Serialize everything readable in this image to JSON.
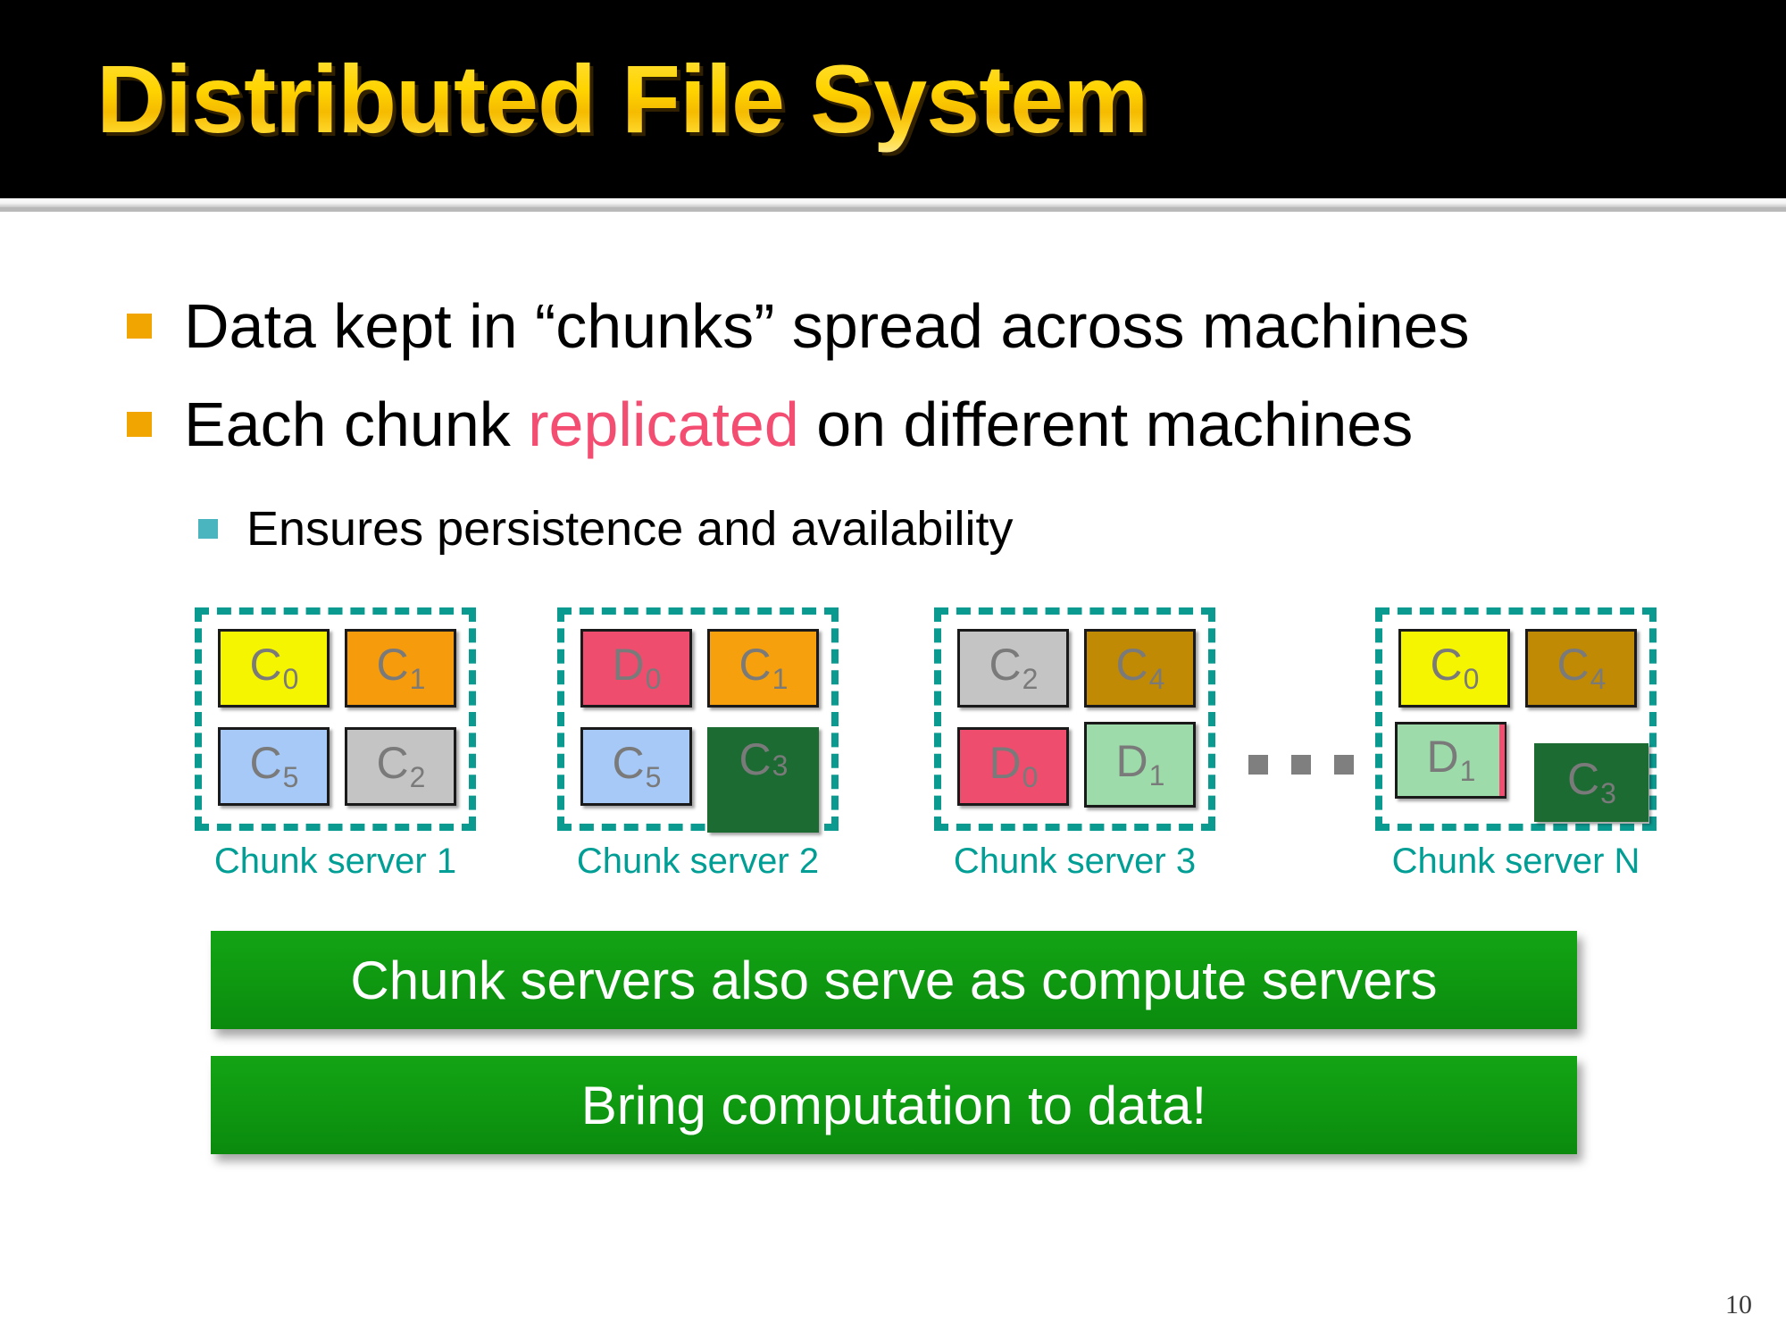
{
  "slide": {
    "title": "Distributed File System",
    "page_number": "10",
    "title_gradient_top": "#ffe247",
    "title_gradient_bottom": "#f5bb00",
    "header_background": "#000000"
  },
  "bullets": [
    {
      "level": 1,
      "marker_color": "#f0a500",
      "prefix": "Data kept in “chunks” spread across machines",
      "accent": "",
      "suffix": ""
    },
    {
      "level": 1,
      "marker_color": "#f0a500",
      "prefix": "Each chunk ",
      "accent": "replicated",
      "accent_color": "#f44d72",
      "suffix": " on different machines"
    },
    {
      "level": 2,
      "marker_color": "#4ab5bf",
      "prefix": "Ensures persistence and availability",
      "accent": "",
      "suffix": ""
    }
  ],
  "diagram": {
    "frame_color": "#0b9a90",
    "label_color": "#009e94",
    "chunk_label_color": "#7a7a7a",
    "ellipsis_color": "#7f7f7f",
    "servers": [
      {
        "label": "Chunk server 1",
        "chunks": [
          {
            "name": "C",
            "index": "0",
            "color": "#f5f500"
          },
          {
            "name": "C",
            "index": "1",
            "color": "#f59b0c"
          },
          {
            "name": "C",
            "index": "5",
            "color": "#a6c9f7"
          },
          {
            "name": "C",
            "index": "2",
            "color": "#c4c4c4"
          }
        ]
      },
      {
        "label": "Chunk server 2",
        "chunks": [
          {
            "name": "D",
            "index": "0",
            "color": "#ef4d6e"
          },
          {
            "name": "C",
            "index": "1",
            "color": "#f5a00c"
          },
          {
            "name": "C",
            "index": "5",
            "color": "#a6c9f7"
          },
          {
            "name": "C",
            "index": "3",
            "color": "#1b6b33"
          }
        ]
      },
      {
        "label": "Chunk server 3",
        "chunks": [
          {
            "name": "C",
            "index": "2",
            "color": "#c4c4c4"
          },
          {
            "name": "C",
            "index": "4",
            "color": "#c08a04"
          },
          {
            "name": "D",
            "index": "0",
            "color": "#ef4d6e"
          },
          {
            "name": "D",
            "index": "1",
            "color": "#9ddcaa"
          }
        ]
      },
      {
        "label": "Chunk server N",
        "chunks": [
          {
            "name": "C",
            "index": "0",
            "color": "#f5f500"
          },
          {
            "name": "C",
            "index": "4",
            "color": "#c08a04"
          },
          {
            "name": "D",
            "index": "1",
            "color": "#9ddcaa"
          },
          {
            "name": "C",
            "index": "3",
            "color": "#1b6b33"
          }
        ]
      }
    ],
    "ellipsis": "..."
  },
  "banners": [
    {
      "text": "Chunk servers also serve as compute servers",
      "color": "#0f9a11"
    },
    {
      "text": "Bring computation to data!",
      "color": "#0f9a11"
    }
  ]
}
